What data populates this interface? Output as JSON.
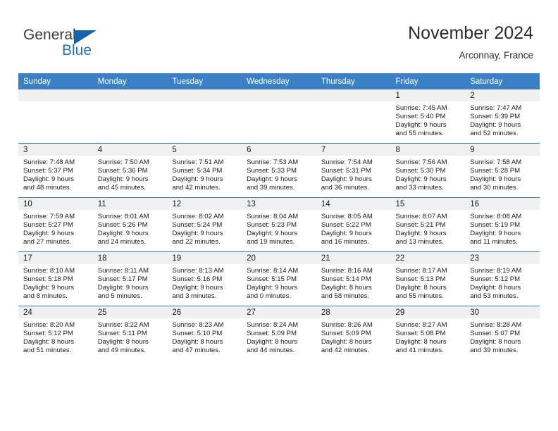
{
  "logo": {
    "word_general": "General",
    "word_blue": "Blue",
    "triangle": "blue-triangle-icon",
    "accent_color": "#1464ac",
    "blue_text_color": "#1f73c4"
  },
  "header": {
    "month_title": "November 2024",
    "location": "Arconnay, France"
  },
  "calendar": {
    "header_color": "#3b7fc4",
    "daynum_band_color": "#f0f0f0",
    "weekdays": [
      "Sunday",
      "Monday",
      "Tuesday",
      "Wednesday",
      "Thursday",
      "Friday",
      "Saturday"
    ],
    "weeks": [
      [
        {
          "day": "",
          "empty": true
        },
        {
          "day": "",
          "empty": true
        },
        {
          "day": "",
          "empty": true
        },
        {
          "day": "",
          "empty": true
        },
        {
          "day": "",
          "empty": true
        },
        {
          "day": "1",
          "sunrise": "Sunrise: 7:45 AM",
          "sunset": "Sunset: 5:40 PM",
          "daylight1": "Daylight: 9 hours",
          "daylight2": "and 55 minutes."
        },
        {
          "day": "2",
          "sunrise": "Sunrise: 7:47 AM",
          "sunset": "Sunset: 5:39 PM",
          "daylight1": "Daylight: 9 hours",
          "daylight2": "and 52 minutes."
        }
      ],
      [
        {
          "day": "3",
          "sunrise": "Sunrise: 7:48 AM",
          "sunset": "Sunset: 5:37 PM",
          "daylight1": "Daylight: 9 hours",
          "daylight2": "and 48 minutes."
        },
        {
          "day": "4",
          "sunrise": "Sunrise: 7:50 AM",
          "sunset": "Sunset: 5:36 PM",
          "daylight1": "Daylight: 9 hours",
          "daylight2": "and 45 minutes."
        },
        {
          "day": "5",
          "sunrise": "Sunrise: 7:51 AM",
          "sunset": "Sunset: 5:34 PM",
          "daylight1": "Daylight: 9 hours",
          "daylight2": "and 42 minutes."
        },
        {
          "day": "6",
          "sunrise": "Sunrise: 7:53 AM",
          "sunset": "Sunset: 5:33 PM",
          "daylight1": "Daylight: 9 hours",
          "daylight2": "and 39 minutes."
        },
        {
          "day": "7",
          "sunrise": "Sunrise: 7:54 AM",
          "sunset": "Sunset: 5:31 PM",
          "daylight1": "Daylight: 9 hours",
          "daylight2": "and 36 minutes."
        },
        {
          "day": "8",
          "sunrise": "Sunrise: 7:56 AM",
          "sunset": "Sunset: 5:30 PM",
          "daylight1": "Daylight: 9 hours",
          "daylight2": "and 33 minutes."
        },
        {
          "day": "9",
          "sunrise": "Sunrise: 7:58 AM",
          "sunset": "Sunset: 5:28 PM",
          "daylight1": "Daylight: 9 hours",
          "daylight2": "and 30 minutes."
        }
      ],
      [
        {
          "day": "10",
          "sunrise": "Sunrise: 7:59 AM",
          "sunset": "Sunset: 5:27 PM",
          "daylight1": "Daylight: 9 hours",
          "daylight2": "and 27 minutes."
        },
        {
          "day": "11",
          "sunrise": "Sunrise: 8:01 AM",
          "sunset": "Sunset: 5:26 PM",
          "daylight1": "Daylight: 9 hours",
          "daylight2": "and 24 minutes."
        },
        {
          "day": "12",
          "sunrise": "Sunrise: 8:02 AM",
          "sunset": "Sunset: 5:24 PM",
          "daylight1": "Daylight: 9 hours",
          "daylight2": "and 22 minutes."
        },
        {
          "day": "13",
          "sunrise": "Sunrise: 8:04 AM",
          "sunset": "Sunset: 5:23 PM",
          "daylight1": "Daylight: 9 hours",
          "daylight2": "and 19 minutes."
        },
        {
          "day": "14",
          "sunrise": "Sunrise: 8:05 AM",
          "sunset": "Sunset: 5:22 PM",
          "daylight1": "Daylight: 9 hours",
          "daylight2": "and 16 minutes."
        },
        {
          "day": "15",
          "sunrise": "Sunrise: 8:07 AM",
          "sunset": "Sunset: 5:21 PM",
          "daylight1": "Daylight: 9 hours",
          "daylight2": "and 13 minutes."
        },
        {
          "day": "16",
          "sunrise": "Sunrise: 8:08 AM",
          "sunset": "Sunset: 5:19 PM",
          "daylight1": "Daylight: 9 hours",
          "daylight2": "and 11 minutes."
        }
      ],
      [
        {
          "day": "17",
          "sunrise": "Sunrise: 8:10 AM",
          "sunset": "Sunset: 5:18 PM",
          "daylight1": "Daylight: 9 hours",
          "daylight2": "and 8 minutes."
        },
        {
          "day": "18",
          "sunrise": "Sunrise: 8:11 AM",
          "sunset": "Sunset: 5:17 PM",
          "daylight1": "Daylight: 9 hours",
          "daylight2": "and 5 minutes."
        },
        {
          "day": "19",
          "sunrise": "Sunrise: 8:13 AM",
          "sunset": "Sunset: 5:16 PM",
          "daylight1": "Daylight: 9 hours",
          "daylight2": "and 3 minutes."
        },
        {
          "day": "20",
          "sunrise": "Sunrise: 8:14 AM",
          "sunset": "Sunset: 5:15 PM",
          "daylight1": "Daylight: 9 hours",
          "daylight2": "and 0 minutes."
        },
        {
          "day": "21",
          "sunrise": "Sunrise: 8:16 AM",
          "sunset": "Sunset: 5:14 PM",
          "daylight1": "Daylight: 8 hours",
          "daylight2": "and 58 minutes."
        },
        {
          "day": "22",
          "sunrise": "Sunrise: 8:17 AM",
          "sunset": "Sunset: 5:13 PM",
          "daylight1": "Daylight: 8 hours",
          "daylight2": "and 55 minutes."
        },
        {
          "day": "23",
          "sunrise": "Sunrise: 8:19 AM",
          "sunset": "Sunset: 5:12 PM",
          "daylight1": "Daylight: 8 hours",
          "daylight2": "and 53 minutes."
        }
      ],
      [
        {
          "day": "24",
          "sunrise": "Sunrise: 8:20 AM",
          "sunset": "Sunset: 5:12 PM",
          "daylight1": "Daylight: 8 hours",
          "daylight2": "and 51 minutes."
        },
        {
          "day": "25",
          "sunrise": "Sunrise: 8:22 AM",
          "sunset": "Sunset: 5:11 PM",
          "daylight1": "Daylight: 8 hours",
          "daylight2": "and 49 minutes."
        },
        {
          "day": "26",
          "sunrise": "Sunrise: 8:23 AM",
          "sunset": "Sunset: 5:10 PM",
          "daylight1": "Daylight: 8 hours",
          "daylight2": "and 47 minutes."
        },
        {
          "day": "27",
          "sunrise": "Sunrise: 8:24 AM",
          "sunset": "Sunset: 5:09 PM",
          "daylight1": "Daylight: 8 hours",
          "daylight2": "and 44 minutes."
        },
        {
          "day": "28",
          "sunrise": "Sunrise: 8:26 AM",
          "sunset": "Sunset: 5:09 PM",
          "daylight1": "Daylight: 8 hours",
          "daylight2": "and 42 minutes."
        },
        {
          "day": "29",
          "sunrise": "Sunrise: 8:27 AM",
          "sunset": "Sunset: 5:08 PM",
          "daylight1": "Daylight: 8 hours",
          "daylight2": "and 41 minutes."
        },
        {
          "day": "30",
          "sunrise": "Sunrise: 8:28 AM",
          "sunset": "Sunset: 5:07 PM",
          "daylight1": "Daylight: 8 hours",
          "daylight2": "and 39 minutes."
        }
      ]
    ]
  }
}
